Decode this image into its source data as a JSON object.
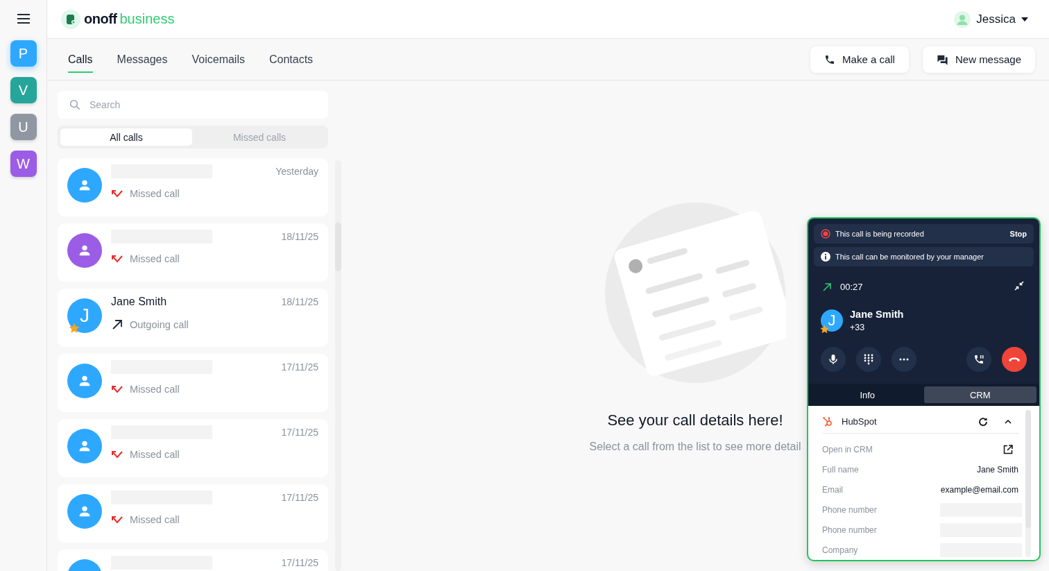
{
  "rail": {
    "workspaces": [
      {
        "letter": "P",
        "color": "#2ea8ff",
        "selected": true
      },
      {
        "letter": "V",
        "color": "#26a69a",
        "selected": false
      },
      {
        "letter": "U",
        "color": "#9097a3",
        "selected": false
      },
      {
        "letter": "W",
        "color": "#9b5de5",
        "selected": false
      }
    ]
  },
  "header": {
    "logo": {
      "brand": "onoff",
      "suffix": "business"
    },
    "user": "Jessica"
  },
  "tabs": [
    {
      "label": "Calls",
      "selected": true
    },
    {
      "label": "Messages",
      "selected": false
    },
    {
      "label": "Voicemails",
      "selected": false
    },
    {
      "label": "Contacts",
      "selected": false
    }
  ],
  "actions": [
    {
      "kind": "call",
      "label": "Make a call"
    },
    {
      "kind": "message",
      "label": "New message"
    }
  ],
  "search": {
    "placeholder": "Search"
  },
  "filters": [
    {
      "label": "All calls",
      "selected": true
    },
    {
      "label": "Missed calls",
      "selected": false
    }
  ],
  "calls": [
    {
      "default_avatar": true,
      "color": "#2ea8ff",
      "favorite": false,
      "kind": "missed",
      "status": "Missed call",
      "date": "Yesterday"
    },
    {
      "default_avatar": true,
      "color": "#9b5de5",
      "favorite": false,
      "kind": "missed",
      "status": "Missed call",
      "date": "18/11/25"
    },
    {
      "name": "Jane Smith",
      "initial": "J",
      "color": "#2ea8ff",
      "favorite": true,
      "kind": "outgoing",
      "status": "Outgoing call",
      "date": "18/11/25"
    },
    {
      "default_avatar": true,
      "color": "#2ea8ff",
      "favorite": false,
      "kind": "missed",
      "status": "Missed call",
      "date": "17/11/25"
    },
    {
      "default_avatar": true,
      "color": "#2ea8ff",
      "favorite": false,
      "kind": "missed",
      "status": "Missed call",
      "date": "17/11/25"
    },
    {
      "default_avatar": true,
      "color": "#2ea8ff",
      "favorite": false,
      "kind": "missed",
      "status": "Missed call",
      "date": "17/11/25"
    },
    {
      "color": "#2ea8ff",
      "favorite": false,
      "date": "17/11/25"
    }
  ],
  "empty_state": {
    "title": "See your call details here!",
    "text": "Select a call from the list to see more detail"
  },
  "call_widget": {
    "banners": [
      {
        "kind": "recording",
        "text": "This call is being recorded",
        "action": "Stop"
      },
      {
        "kind": "info",
        "text": "This call can be monitored by your manager"
      }
    ],
    "timer": "00:27",
    "contact": {
      "name": "Jane Smith",
      "number": "+33",
      "initial": "J",
      "favorite": true
    },
    "controls": [
      {
        "kind": "mic"
      },
      {
        "kind": "keypad"
      },
      {
        "kind": "more"
      },
      {
        "kind": "hold"
      },
      {
        "kind": "hangup"
      }
    ],
    "tabs": [
      {
        "label": "Info",
        "selected": false
      },
      {
        "label": "CRM",
        "selected": true
      }
    ],
    "crm": {
      "name": "HubSpot",
      "expanded": true,
      "fields": [
        {
          "kind": "link",
          "label": "Open in CRM"
        },
        {
          "kind": "text",
          "label": "Full name",
          "value": "Jane Smith"
        },
        {
          "kind": "text",
          "label": "Email",
          "value": "example@email.com"
        },
        {
          "kind": "blank",
          "label": "Phone number"
        },
        {
          "kind": "blank",
          "label": "Phone number"
        },
        {
          "kind": "blank",
          "label": "Company"
        }
      ]
    }
  }
}
